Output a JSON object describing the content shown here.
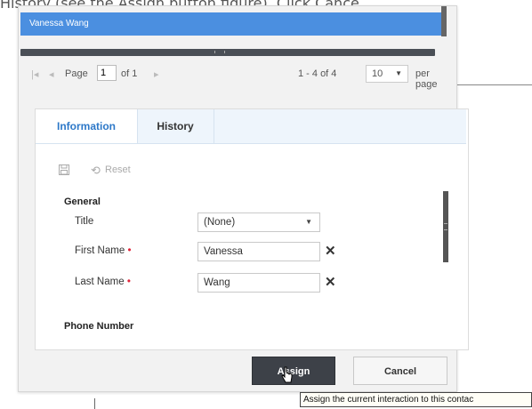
{
  "page": {
    "background_text": "History (see the Assign button figure). Click Cance"
  },
  "grid": {
    "selected_row": "Vanessa Wang"
  },
  "pager": {
    "page_label": "Page",
    "page_value": "1",
    "of_label": "of 1",
    "range": "1 - 4 of 4",
    "per_page_value": "10",
    "per_page_label": "per page"
  },
  "tabs": [
    {
      "label": "Information",
      "active": true
    },
    {
      "label": "History",
      "active": false
    }
  ],
  "toolbar": {
    "save_icon": "floppy-disk-icon",
    "reset_icon": "reset-icon",
    "reset_label": "Reset"
  },
  "form": {
    "general_title": "General",
    "fields": [
      {
        "label": "Title",
        "value": "(None)",
        "required": false,
        "type": "select"
      },
      {
        "label": "First Name",
        "value": "Vanessa",
        "required": true,
        "type": "text"
      },
      {
        "label": "Last Name",
        "value": "Wang",
        "required": true,
        "type": "text"
      }
    ],
    "phone_title": "Phone Number"
  },
  "buttons": {
    "assign": "Assign",
    "cancel": "Cancel"
  },
  "tooltip": {
    "text": "Assign the current interaction to this contac"
  },
  "colors": {
    "selection": "#4b8fe0",
    "active_tab": "#2d78c8",
    "required": "#e0243a",
    "assign_button": "#3d4148"
  }
}
